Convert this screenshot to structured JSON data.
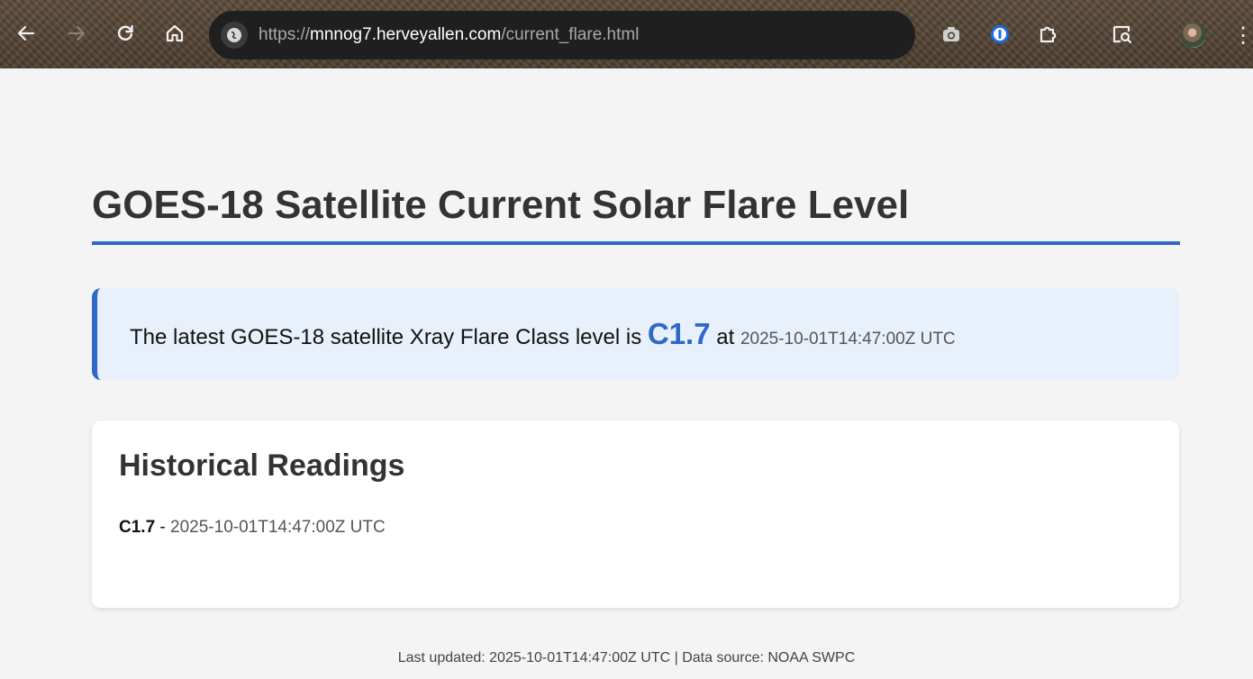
{
  "browser": {
    "url_scheme": "https://",
    "url_host": "mnnog7.herveyallen.com",
    "url_path": "/current_flare.html",
    "icons": [
      "back-arrow-icon",
      "forward-arrow-icon",
      "reload-icon",
      "home-icon",
      "site-info-icon",
      "camera-icon",
      "password-manager-icon",
      "extensions-icon",
      "reading-list-icon",
      "profile-avatar",
      "menu-dots-icon"
    ]
  },
  "page": {
    "title": "GOES-18 Satellite Current Solar Flare Level",
    "current": {
      "prefix": "The latest GOES-18 satellite Xray Flare Class level is ",
      "flare_class": "C1.7",
      "at": " at ",
      "timestamp": "2025-10-01T14:47:00Z UTC"
    },
    "history": {
      "title": "Historical Readings",
      "readings": [
        {
          "flare_class": "C1.7",
          "separator": " - ",
          "timestamp": "2025-10-01T14:47:00Z UTC"
        }
      ]
    },
    "footer": "Last updated: 2025-10-01T14:47:00Z UTC | Data source: NOAA SWPC"
  },
  "colors": {
    "accent": "#2f68c8",
    "info_background": "#e7f0fb",
    "page_background": "#f4f4f4"
  }
}
